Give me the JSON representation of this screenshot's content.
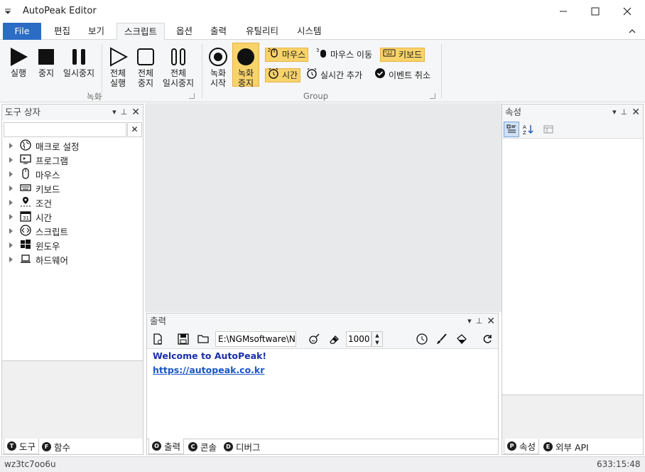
{
  "window": {
    "title": "AutoPeak Editor"
  },
  "menu": {
    "tabs": [
      "File",
      "편집",
      "보기",
      "스크립트",
      "옵션",
      "출력",
      "유틸리티",
      "시스템"
    ]
  },
  "ribbon": {
    "record_group_label": "녹화",
    "group2_label": "Group",
    "run": "실행",
    "stop": "중지",
    "pause": "일시중지",
    "run_all_1": "전체",
    "run_all_2": "실행",
    "stop_all_1": "전체",
    "stop_all_2": "중지",
    "pause_all_1": "전체",
    "pause_all_2": "일시중지",
    "rec_start_1": "녹화",
    "rec_start_2": "시작",
    "rec_stop_1": "녹화",
    "rec_stop_2": "중지",
    "mouse": "마우스",
    "mouse_move": "마우스 이동",
    "keyboard": "키보드",
    "time": "시간",
    "realtime_add": "실시간 추가",
    "event_cancel": "이벤트 취소"
  },
  "toolbox": {
    "title": "도구 상자",
    "search_value": "",
    "items": [
      "매크로 설정",
      "프로그램",
      "마우스",
      "키보드",
      "조건",
      "시간",
      "스크립트",
      "윈도우",
      "하드웨어"
    ],
    "tabs": [
      "도구",
      "함수"
    ],
    "tab_letters": [
      "T",
      "F"
    ]
  },
  "output": {
    "title": "출력",
    "path": "E:\\NGMsoftware\\NG",
    "count": "1000",
    "welcome": "Welcome to AutoPeak!",
    "link": "https://autopeak.co.kr",
    "tabs": [
      "출력",
      "콘솔",
      "디버그"
    ],
    "tab_letters": [
      "O",
      "C",
      "D"
    ]
  },
  "properties": {
    "title": "속성",
    "tabs": [
      "속성",
      "외부 API"
    ],
    "tab_letters": [
      "P",
      "E"
    ]
  },
  "status": {
    "left": "wz3tc7oo6u",
    "right": "633:15:48"
  },
  "colors": {
    "accent": "#2b6cc4",
    "highlight": "#f8d36a",
    "link": "#1a56c4",
    "welcome": "#1a2fa8"
  }
}
